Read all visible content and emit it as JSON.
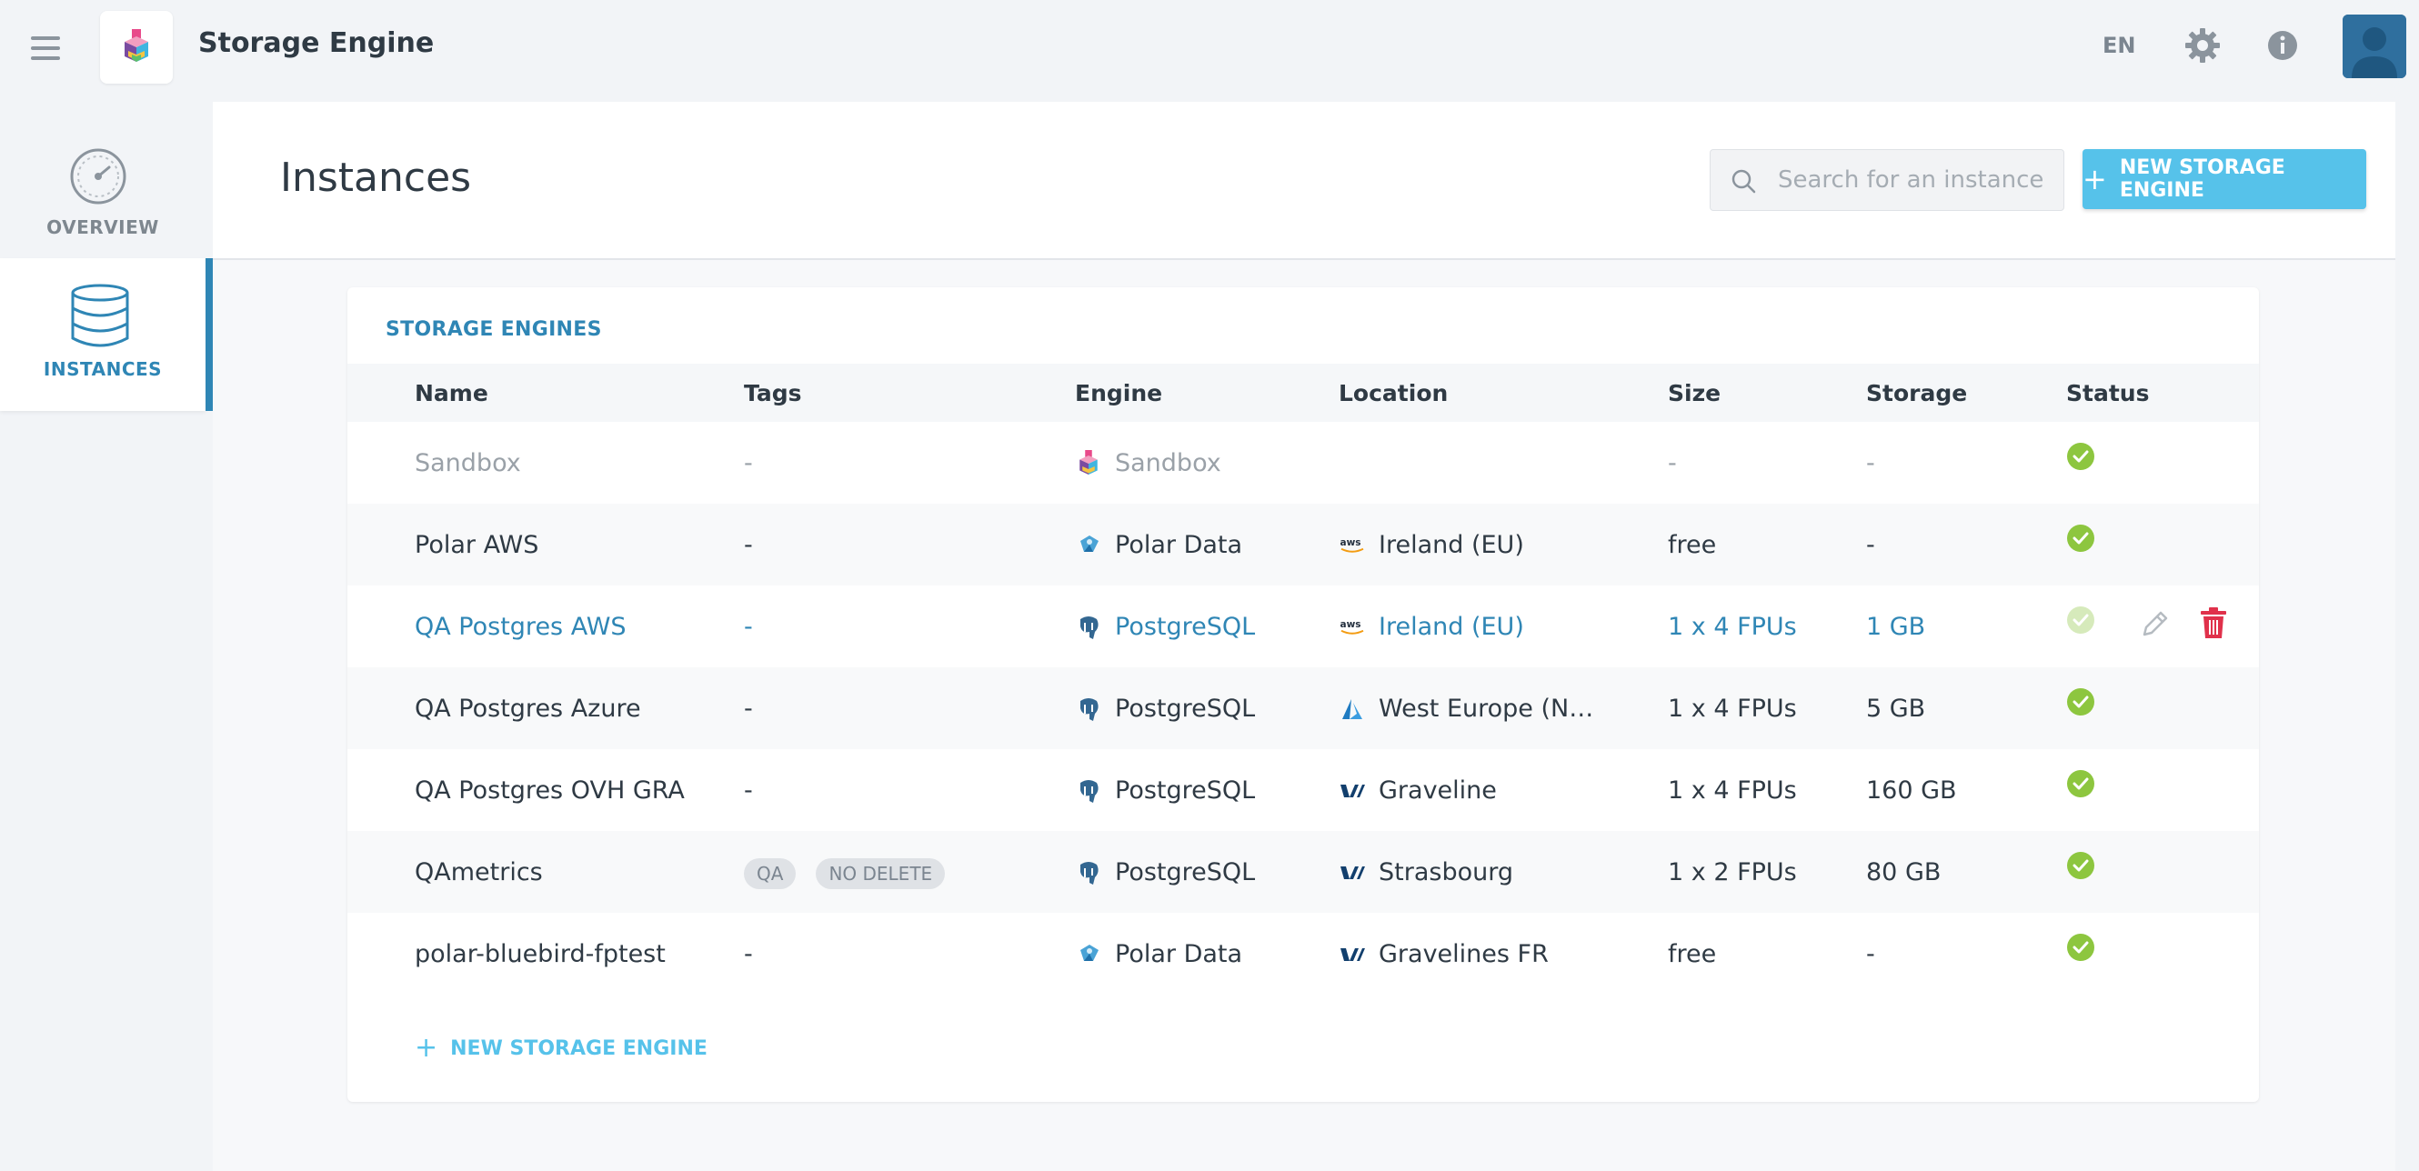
{
  "app": {
    "title": "Storage Engine"
  },
  "topbar": {
    "lang": "EN"
  },
  "sidebar": {
    "items": [
      {
        "label": "OVERVIEW",
        "icon": "gauge-icon"
      },
      {
        "label": "INSTANCES",
        "icon": "database-icon",
        "active": true
      }
    ]
  },
  "page": {
    "title": "Instances"
  },
  "search": {
    "placeholder": "Search for an instance"
  },
  "new_button": {
    "label": "NEW STORAGE ENGINE"
  },
  "card": {
    "title": "STORAGE ENGINES",
    "add_label": "NEW STORAGE ENGINE"
  },
  "table": {
    "columns": [
      "Name",
      "Tags",
      "Engine",
      "Location",
      "Size",
      "Storage",
      "Status"
    ],
    "rows": [
      {
        "name": "Sandbox",
        "tags": "-",
        "engine": "Sandbox",
        "engine_icon": "sandbox-logo-icon",
        "location": "",
        "location_icon": "",
        "size": "-",
        "storage": "-",
        "status": "ok"
      },
      {
        "name": "Polar AWS",
        "tags": "-",
        "engine": "Polar Data",
        "engine_icon": "polar-data-icon",
        "location": "Ireland (EU)",
        "location_icon": "aws-icon",
        "size": "free",
        "storage": "-",
        "status": "ok"
      },
      {
        "name": "QA Postgres AWS",
        "tags": "-",
        "engine": "PostgreSQL",
        "engine_icon": "postgresql-icon",
        "location": "Ireland (EU)",
        "location_icon": "aws-icon",
        "size": "1 x 4 FPUs",
        "storage": "1 GB",
        "status": "ok"
      },
      {
        "name": "QA Postgres Azure",
        "tags": "-",
        "engine": "PostgreSQL",
        "engine_icon": "postgresql-icon",
        "location": "West Europe (N…",
        "location_icon": "azure-icon",
        "size": "1 x 4 FPUs",
        "storage": "5 GB",
        "status": "ok"
      },
      {
        "name": "QA Postgres OVH GRA",
        "tags": "-",
        "engine": "PostgreSQL",
        "engine_icon": "postgresql-icon",
        "location": "Graveline",
        "location_icon": "ovh-icon",
        "size": "1 x 4 FPUs",
        "storage": "160 GB",
        "status": "ok"
      },
      {
        "name": "QAmetrics",
        "tags": [
          "QA",
          "NO DELETE"
        ],
        "engine": "PostgreSQL",
        "engine_icon": "postgresql-icon",
        "location": "Strasbourg",
        "location_icon": "ovh-icon",
        "size": "1 x 2 FPUs",
        "storage": "80 GB",
        "status": "ok"
      },
      {
        "name": "polar-bluebird-fptest",
        "tags": "-",
        "engine": "Polar Data",
        "engine_icon": "polar-data-icon",
        "location": "Gravelines FR",
        "location_icon": "ovh-icon",
        "size": "free",
        "storage": "-",
        "status": "ok"
      }
    ]
  },
  "colors": {
    "accent": "#2f86b5",
    "button": "#56c2ea",
    "status_ok": "#8dc63f",
    "delete": "#e0314b"
  }
}
